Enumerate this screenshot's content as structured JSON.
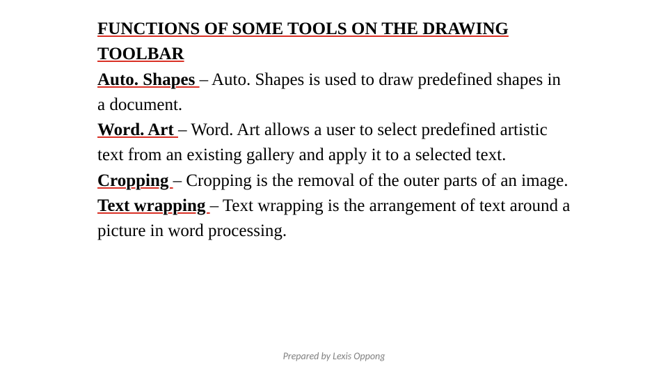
{
  "title": "FUNCTIONS OF SOME TOOLS ON THE DRAWING TOOLBAR",
  "items": [
    {
      "term": "Auto. Shapes ",
      "desc": "– Auto. Shapes is used to draw predefined shapes in a document."
    },
    {
      "term": "Word. Art ",
      "desc": "– Word. Art allows a user to select predefined artistic text from an existing gallery and apply it to a selected text."
    },
    {
      "term": "Cropping ",
      "desc": "– Cropping is the removal of the outer parts of an image."
    },
    {
      "term": "Text wrapping ",
      "desc": "– Text wrapping is the arrangement of text around a picture in word processing."
    }
  ],
  "footer": "Prepared by Lexis Oppong"
}
